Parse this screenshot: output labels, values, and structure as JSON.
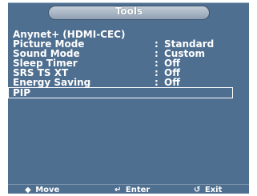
{
  "header": {
    "title": "Tools"
  },
  "menu": {
    "items": [
      {
        "label": "Anynet+ (HDMI-CEC)",
        "colon": "",
        "value": ""
      },
      {
        "label": "Picture Mode",
        "colon": ":",
        "value": "Standard"
      },
      {
        "label": "Sound Mode",
        "colon": ":",
        "value": "Custom"
      },
      {
        "label": "Sleep Timer",
        "colon": ":",
        "value": "Off"
      },
      {
        "label": "SRS TS XT",
        "colon": ":",
        "value": "Off"
      },
      {
        "label": "Energy Saving",
        "colon": ":",
        "value": "Off"
      },
      {
        "label": "PIP",
        "colon": "",
        "value": ""
      }
    ]
  },
  "footer": {
    "move_icon": "◆",
    "move_label": "Move",
    "enter_icon": "↵",
    "enter_label": "Enter",
    "exit_icon": "↺",
    "exit_label": "Exit"
  }
}
